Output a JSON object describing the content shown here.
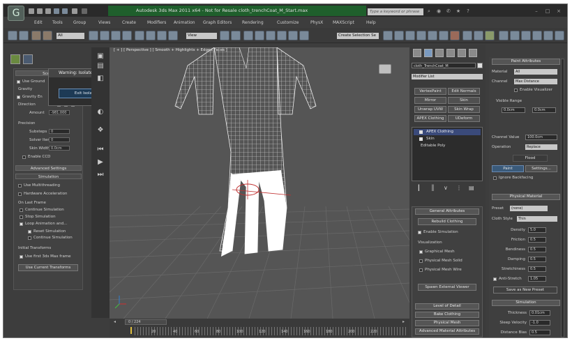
{
  "title": "Autodesk 3ds Max 2011 x64 - Not for Resale   cloth_trenchCoat_M_Start.max",
  "search_placeholder": "Type a keyword or phrase",
  "menu": [
    "Edit",
    "Tools",
    "Group",
    "Views",
    "Create",
    "Modifiers",
    "Animation",
    "Graph Editors",
    "Rendering",
    "Customize",
    "PhysX",
    "MAXScript",
    "Help"
  ],
  "toolbar": {
    "filter": "All",
    "view": "View",
    "selection_set": "Create Selection Se"
  },
  "viewport_label": "[ + ] [ Perspective ] [ Smooth + Highlights + Edged Faces ]",
  "dialog": {
    "title": "Warning: Isolated Sele...",
    "button": "Exit Isolation Mode"
  },
  "left": {
    "scene_header": "Scene",
    "use_ground": "Use Ground",
    "gravity": "Gravity",
    "gravity_en": "Gravity En",
    "direction": "Direction",
    "amount": "Amount",
    "amount_val": "-981.000",
    "z": "Z",
    "precision": "Precision",
    "substeps": "Substeps",
    "substeps_val": "0",
    "solver_iter": "Solver Iter",
    "solver_iter_val": "0",
    "skin_width": "Skin Width",
    "skin_width_val": "0.0cm",
    "enable_ccd": "Enable CCD",
    "advanced": "Advanced Settings",
    "simulation": "Simulation",
    "use_multithreading": "Use Multithreading",
    "hardware_accel": "Hardware Acceleration",
    "on_last_frame": "On Last Frame",
    "continue_sim": "Continue Simulation",
    "stop_sim": "Stop Simulation",
    "loop_anim": "Loop Animation and...",
    "reset_sim": "Reset Simulation",
    "continue_sim2": "Continue Simulation",
    "initial_transforms": "Initial Transforms",
    "use_first": "Use first 3ds Max frame",
    "use_current": "Use Current Transforms"
  },
  "timeline": {
    "slider": "0 / 224",
    "ticks": [
      "0",
      "20",
      "40",
      "60",
      "80",
      "100",
      "120",
      "140",
      "160",
      "180",
      "200",
      "220"
    ]
  },
  "cmd": {
    "object_name": "cloth_TrenchCoat_M",
    "modifier_list": "Modifier List",
    "buttons": [
      "VertexPaint",
      "Edit Normals",
      "Mirror",
      "Skin",
      "Unwrap UVW",
      "Skin Wrap",
      "APEX Clothing",
      "UDeform"
    ],
    "stack": [
      "APEX Clothing",
      "Skin",
      "Editable Poly"
    ],
    "general_header": "General Attributes",
    "rebuild": "Rebuild Clothing",
    "enable_sim": "Enable Simulation",
    "visualization": "Visualization",
    "graphical_mesh": "Graphical Mesh",
    "physical_solid": "Physical Mesh Solid",
    "physical_wire": "Physical Mesh Wire",
    "spawn_viewer": "Spawn External Viewer",
    "lod": "Level of Detail",
    "bake": "Bake Clothing",
    "physical_mesh": "Physical Mesh",
    "advanced_mat": "Advanced Material Attributes"
  },
  "right": {
    "paint_attr": "Paint Attributes",
    "material": "Material",
    "material_val": "All",
    "channel": "Channel",
    "channel_val": "Max Distance",
    "enable_vis": "Enable Visualizer",
    "visible_range": "Visible Range",
    "range_min": "0.0cm",
    "range_max": "0.0cm",
    "channel_value": "Channel Value",
    "channel_value_val": "100.0cm",
    "operation": "Operation",
    "operation_val": "Replace",
    "flood": "Flood",
    "paint": "Paint",
    "settings": "Settings...",
    "ignore_backfacing": "Ignore Backfacing",
    "physical_material": "Physical Material",
    "preset": "Preset",
    "preset_val": "(none)",
    "cloth_style": "Cloth Style",
    "cloth_style_val": "Thin",
    "params": [
      {
        "label": "Density",
        "value": "5.0"
      },
      {
        "label": "Friction",
        "value": "0.5"
      },
      {
        "label": "Bendiness",
        "value": "0.5"
      },
      {
        "label": "Damping",
        "value": "0.5"
      },
      {
        "label": "Stretchiness",
        "value": "0.5"
      },
      {
        "label": "Anti-Stretch",
        "value": "1.05"
      }
    ],
    "save_preset": "Save as New Preset",
    "sim_header": "Simulation",
    "thickness": "Thickness",
    "thickness_val": "0.01cm",
    "sleep_velocity": "Sleep Velocity",
    "sleep_velocity_val": "-1.0",
    "distance_bias": "Distance Bias",
    "distance_bias_val": "0.5"
  }
}
